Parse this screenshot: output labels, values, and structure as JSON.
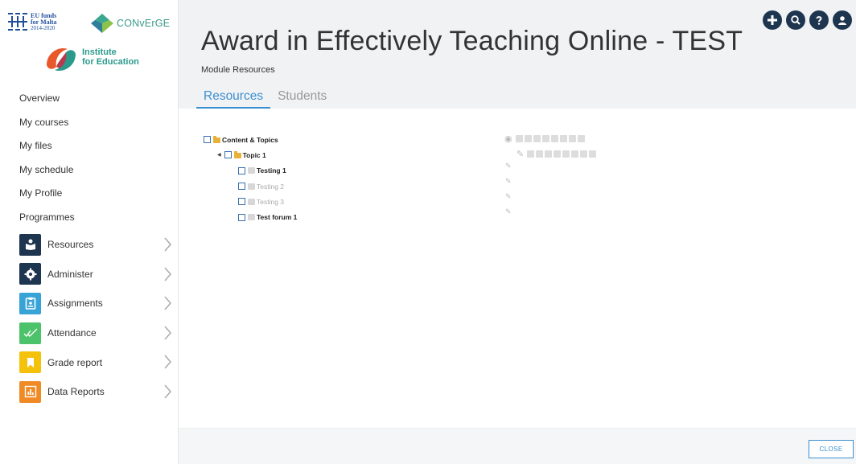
{
  "logos": {
    "eu": {
      "line1": "EU funds",
      "line2": "for Malta",
      "line3": "2014-2020"
    },
    "converge": {
      "name": "CONvErGE"
    },
    "ife": {
      "line1": "Institute",
      "line2": "for Education"
    }
  },
  "sidebar": {
    "links": [
      "Overview",
      "My courses",
      "My files",
      "My schedule",
      "My Profile",
      "Programmes"
    ],
    "tiles": [
      {
        "label": "Resources",
        "color": "#1e3550",
        "icon": "book-person-icon"
      },
      {
        "label": "Administer",
        "color": "#1e3550",
        "icon": "gear-icon"
      },
      {
        "label": "Assignments",
        "color": "#38a3d6",
        "icon": "clipboard-icon"
      },
      {
        "label": "Attendance",
        "color": "#4cc26a",
        "icon": "double-check-icon"
      },
      {
        "label": "Grade report",
        "color": "#f5c20b",
        "icon": "bookmark-icon"
      },
      {
        "label": "Data Reports",
        "color": "#f08a24",
        "icon": "bar-chart-icon"
      }
    ]
  },
  "header": {
    "title": "Award in Effectively Teaching Online - TEST",
    "subtitle": "Module Resources",
    "tabs": [
      {
        "label": "Resources",
        "active": true
      },
      {
        "label": "Students",
        "active": false
      }
    ],
    "icons": [
      "plus-icon",
      "search-icon",
      "help-icon",
      "user-icon"
    ],
    "accent": "#3b8fd0"
  },
  "tree": {
    "root": {
      "label": "Content & Topics"
    },
    "topic": {
      "label": "Topic 1"
    },
    "items": [
      {
        "label": "Testing 1",
        "visible": true
      },
      {
        "label": "Testing 2",
        "visible": false
      },
      {
        "label": "Testing 3",
        "visible": false
      },
      {
        "label": "Test forum 1",
        "visible": true
      }
    ]
  },
  "footer": {
    "close_label": "CLOSE"
  }
}
